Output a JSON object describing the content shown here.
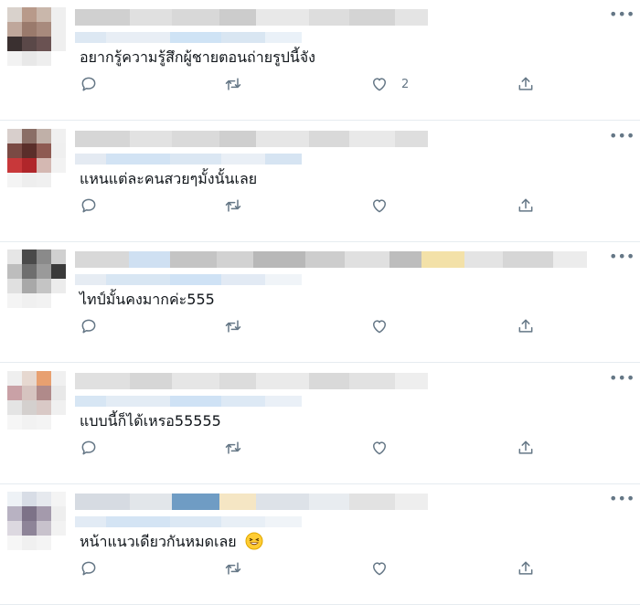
{
  "replies": [
    {
      "text": "อยากรู้ความรู้สึกผู้ชายตอนถ่ายรูปนี้จัง",
      "like_count": "2",
      "avatar_colors": [
        "#d9d2cc",
        "#b89a8a",
        "#c9b7ab",
        "#efefef",
        "#bfa79b",
        "#9a7a6c",
        "#a88a7d",
        "#efefef",
        "#3a3030",
        "#5a4848",
        "#6a5252",
        "#efefef",
        "#f2f2f2",
        "#e8e8e8",
        "#eeeeee",
        "#ffffff"
      ],
      "name_colors": [
        "#d0d0d0",
        "#e0e0e0",
        "#d8d8d8",
        "#cccccc",
        "#e8e8e8",
        "#dddddd",
        "#d4d4d4",
        "#e4e4e4"
      ],
      "handle_colors": [
        "#dde8f3",
        "#e8eef5",
        "#cfe3f5",
        "#d9e6f2",
        "#eaf1f8"
      ]
    },
    {
      "text": "แหนแต่ละคนสวยๆมั้งนั้นเลย",
      "like_count": "",
      "avatar_colors": [
        "#d8cfcc",
        "#8a6e66",
        "#c0b0a8",
        "#f0f0f0",
        "#7a4a44",
        "#5a2e2a",
        "#8e5a52",
        "#efefef",
        "#c8383a",
        "#b0262a",
        "#d4b8b2",
        "#f2f2f2",
        "#f4f4f4",
        "#eeeeee",
        "#f0f0f0",
        "#ffffff"
      ],
      "name_colors": [
        "#d6d6d6",
        "#e2e2e2",
        "#dadada",
        "#cfcfcf",
        "#e6e6e6",
        "#d9d9d9",
        "#e9e9e9",
        "#dedede"
      ],
      "handle_colors": [
        "#e4eaf2",
        "#d2e3f4",
        "#dbe7f3",
        "#e9eff6",
        "#d6e4f2"
      ]
    },
    {
      "text": "ไทป์มั้นคงมากค่ะ555",
      "like_count": "",
      "avatar_colors": [
        "#e6e6e6",
        "#4a4a4a",
        "#8a8a8a",
        "#d0d0d0",
        "#bdbdbd",
        "#6e6e6e",
        "#9a9a9a",
        "#3a3a3a",
        "#e0e0e0",
        "#a8a8a8",
        "#c4c4c4",
        "#ececec",
        "#f4f4f4",
        "#f0f0f0",
        "#f2f2f2",
        "#ffffff"
      ],
      "name_colors": [
        "#d8d8d8",
        "#cfe0f2",
        "#c4c4c4",
        "#d2d2d2",
        "#b8b8b8",
        "#cdcdcd",
        "#e0e0e0",
        "#bdbdbd",
        "#f3e1a8",
        "#e4e4e4",
        "#d6d6d6",
        "#ececec"
      ],
      "handle_colors": [
        "#e6ecf3",
        "#d8e6f3",
        "#cfe2f5",
        "#e2eaf4",
        "#f0f4f8"
      ]
    },
    {
      "text": "แบบนี้ก็ได้เหรอ55555",
      "like_count": "",
      "avatar_colors": [
        "#efefef",
        "#e6d8d0",
        "#e8a070",
        "#f0f0f0",
        "#c9a1a6",
        "#d6c4c0",
        "#b08a8a",
        "#e8e8e8",
        "#e4e4e4",
        "#d4d0ce",
        "#d9c9c6",
        "#f0f0f0",
        "#f6f6f6",
        "#f2f2f2",
        "#f4f4f4",
        "#ffffff"
      ],
      "name_colors": [
        "#e0e0e0",
        "#d6d6d6",
        "#e6e6e6",
        "#dcdcdc",
        "#eaeaea",
        "#d9d9d9",
        "#e2e2e2",
        "#eeeeee"
      ],
      "handle_colors": [
        "#d7e6f4",
        "#e3ecf5",
        "#cfe2f5",
        "#dde9f5",
        "#eaf0f7"
      ]
    },
    {
      "text": "หน้าแนวเดียวกันหมดเลย",
      "like_count": "",
      "avatar_colors": [
        "#eef2f6",
        "#d8dde6",
        "#e6e9ee",
        "#f4f4f4",
        "#b8b2c2",
        "#7d7288",
        "#a49aac",
        "#eeeeee",
        "#dcd8e0",
        "#8e8498",
        "#c8c2cc",
        "#f2f2f2",
        "#f6f6f6",
        "#f0f0f0",
        "#f4f4f4",
        "#ffffff"
      ],
      "name_colors": [
        "#d6dbe2",
        "#e2e6ea",
        "#6f9cc4",
        "#f5e6c4",
        "#dde2e8",
        "#e8ecf0",
        "#e2e2e2",
        "#eeeeee"
      ],
      "handle_colors": [
        "#e2ebf5",
        "#d4e4f4",
        "#dce8f4",
        "#e8eff6",
        "#f0f4f8"
      ]
    }
  ],
  "icons": {
    "more": "more-icon",
    "reply": "reply-icon",
    "retweet": "retweet-icon",
    "like": "heart-icon",
    "share": "share-icon",
    "emoji": "grinning-emoji-icon"
  },
  "colors": {
    "icon_gray": "#657786",
    "divider": "#e6ecf0",
    "text": "#0f1419"
  }
}
